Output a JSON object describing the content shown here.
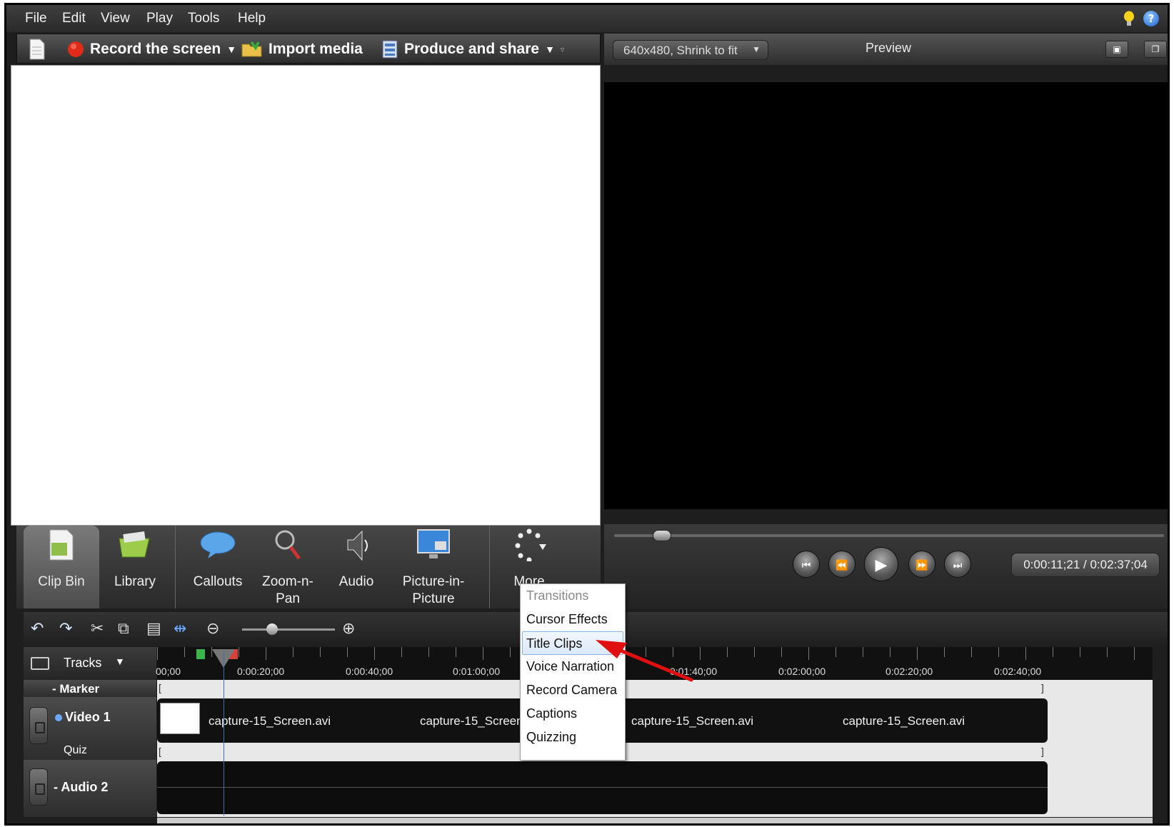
{
  "menubar": {
    "items": [
      "File",
      "Edit",
      "View",
      "Play",
      "Tools",
      "Help"
    ]
  },
  "toolbar": {
    "record_label": "Record the screen",
    "import_label": "Import media",
    "produce_label": "Produce and share"
  },
  "preview": {
    "size_option": "640x480, Shrink to fit",
    "title": "Preview",
    "timecode": "0:00:11;21 / 0:02:37;04",
    "scrub_fraction": 0.07
  },
  "tasks": {
    "clip_bin": "Clip Bin",
    "library": "Library",
    "callouts": "Callouts",
    "zoom_line1": "Zoom-n-",
    "zoom_line2": "Pan",
    "audio": "Audio",
    "pip_line1": "Picture-in-",
    "pip_line2": "Picture",
    "more": "More"
  },
  "more_menu": {
    "items": [
      "Transitions",
      "Cursor Effects",
      "Title Clips",
      "Voice Narration",
      "Record Camera",
      "Captions",
      "Quizzing"
    ],
    "disabled_item": "Transitions",
    "highlighted_item": "Title Clips"
  },
  "timeline": {
    "tracks_label": "Tracks",
    "ruler_labels": [
      "00;00",
      "0:00:20;00",
      "0:00:40;00",
      "0:01:00;00",
      "0:01:40;00",
      "0:02:00;00",
      "0:02:20;00",
      "0:02:40;00"
    ],
    "marker_label": "- Marker",
    "video_label": "Video 1",
    "quiz_label": "Quiz",
    "audio_label": "- Audio 2",
    "clip_names": [
      "capture-15_Screen.avi",
      "capture-15_Screen",
      "capture-15_Screen.avi",
      "capture-15_Screen.avi"
    ]
  },
  "colors": {
    "annotation_arrow": "#e01010",
    "record_dot": "#e02a1a"
  }
}
